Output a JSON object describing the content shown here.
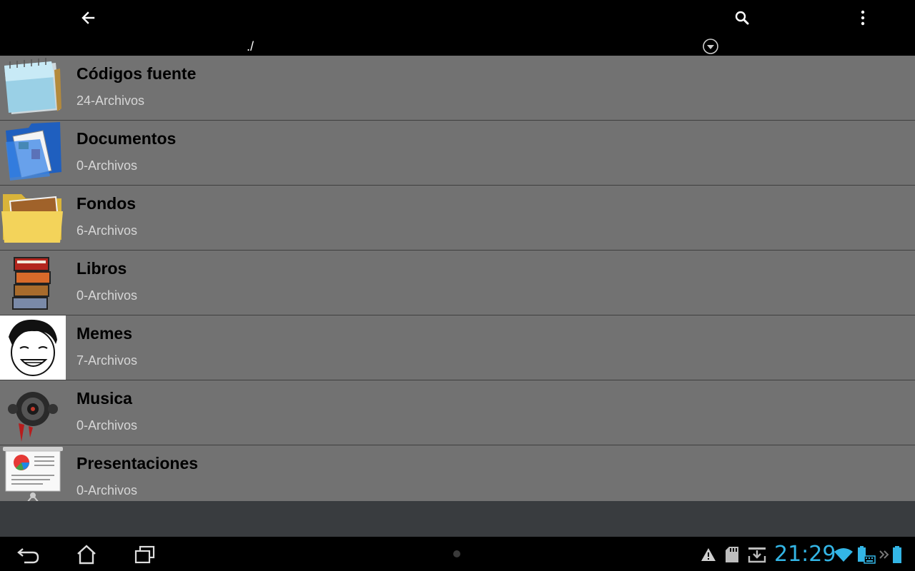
{
  "action_bar": {
    "back_icon": "arrow-left-icon",
    "search_icon": "search-icon",
    "overflow_icon": "more-vertical-icon",
    "path": "./",
    "dropdown_icon": "chevron-down-circle-icon"
  },
  "folders": [
    {
      "name": "Códigos fuente",
      "count": "24-Archivos",
      "icon": "notepad-icon"
    },
    {
      "name": "Documentos",
      "count": "0-Archivos",
      "icon": "documents-folder-icon"
    },
    {
      "name": "Fondos",
      "count": "6-Archivos",
      "icon": "pictures-folder-icon"
    },
    {
      "name": "Libros",
      "count": "0-Archivos",
      "icon": "books-icon"
    },
    {
      "name": "Memes",
      "count": "7-Archivos",
      "icon": "meme-face-icon"
    },
    {
      "name": "Musica",
      "count": "0-Archivos",
      "icon": "speaker-icon"
    },
    {
      "name": "Presentaciones",
      "count": "0-Archivos",
      "icon": "presentation-icon"
    }
  ],
  "system_bar": {
    "time": "21:29",
    "accent_color": "#33b5e5",
    "icons": [
      "back-nav-icon",
      "home-icon",
      "recent-apps-icon",
      "warning-icon",
      "sd-card-icon",
      "download-icon",
      "wifi-icon",
      "battery-keyboard-icon",
      "chevron-double-right-icon",
      "battery-icon"
    ]
  }
}
